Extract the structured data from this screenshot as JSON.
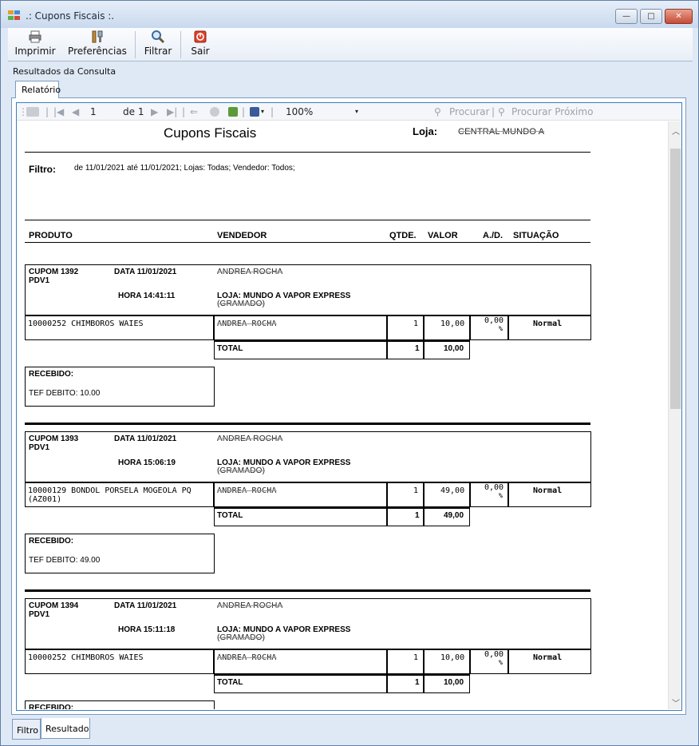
{
  "window": {
    "title": ".: Cupons Fiscais :.",
    "min": "—",
    "max": "□",
    "close": "✕"
  },
  "toolbar": {
    "print": "Imprimir",
    "prefs": "Preferências",
    "filter": "Filtrar",
    "exit": "Sair"
  },
  "group_label": "Resultados da Consulta",
  "tab_report": "Relatório",
  "viewer": {
    "page": "1",
    "of": "de 1",
    "zoom": "100%",
    "find": "Procurar",
    "find_next": "Procurar Próximo",
    "sep": "|"
  },
  "report": {
    "title": "Cupons Fiscais",
    "store_label": "Loja:",
    "store_value": "CENTRAL MUNDO A",
    "filter_label": "Filtro:",
    "filter_value": "de 11/01/2021 até 11/01/2021; Lojas: Todas; Vendedor: Todos;",
    "headers": {
      "product": "PRODUTO",
      "seller": "VENDEDOR",
      "qty": "QTDE.",
      "value": "VALOR",
      "ad": "A./D.",
      "status": "SITUAÇÃO"
    },
    "coupons": [
      {
        "cupom": "CUPOM 1392",
        "pdv": "PDV1",
        "date": "DATA 11/01/2021",
        "time": "HORA 14:41:11",
        "seller": "ANDREA ROCHA",
        "store": "LOJA: MUNDO A VAPOR EXPRESS",
        "store2": "(GRAMADO)",
        "product": "10000252 CHIMBOROS WAIES",
        "product2": "",
        "item_seller": "ANDREA ROCHA",
        "qty": "1",
        "value": "10,00",
        "ad": "0,00",
        "pct": "%",
        "status": "Normal",
        "total_label": "TOTAL",
        "total_qty": "1",
        "total_value": "10,00",
        "received_label": "RECEBIDO:",
        "received": "TEF DEBITO: 10.00"
      },
      {
        "cupom": "CUPOM 1393",
        "pdv": "PDV1",
        "date": "DATA 11/01/2021",
        "time": "HORA 15:06:19",
        "seller": "ANDREA ROCHA",
        "store": "LOJA: MUNDO A VAPOR EXPRESS",
        "store2": "(GRAMADO)",
        "product": "10000129 BONDOL PORSELA MOGEOLA PQ",
        "product2": "(AZ001)",
        "item_seller": "ANDREA ROCHA",
        "qty": "1",
        "value": "49,00",
        "ad": "0,00",
        "pct": "%",
        "status": "Normal",
        "total_label": "TOTAL",
        "total_qty": "1",
        "total_value": "49,00",
        "received_label": "RECEBIDO:",
        "received": "TEF DEBITO: 49.00"
      },
      {
        "cupom": "CUPOM 1394",
        "pdv": "PDV1",
        "date": "DATA 11/01/2021",
        "time": "HORA 15:11:18",
        "seller": "ANDREA ROCHA",
        "store": "LOJA: MUNDO A VAPOR EXPRESS",
        "store2": "(GRAMADO)",
        "product": "10000252 CHIMBOROS WAIES",
        "product2": "",
        "item_seller": "ANDREA ROCHA",
        "qty": "1",
        "value": "10,00",
        "ad": "0,00",
        "pct": "%",
        "status": "Normal",
        "total_label": "TOTAL",
        "total_qty": "1",
        "total_value": "10,00",
        "received_label": "RECEBIDO:",
        "received": ""
      }
    ]
  },
  "bottom_tabs": {
    "filter": "Filtro",
    "result": "Resultado"
  }
}
